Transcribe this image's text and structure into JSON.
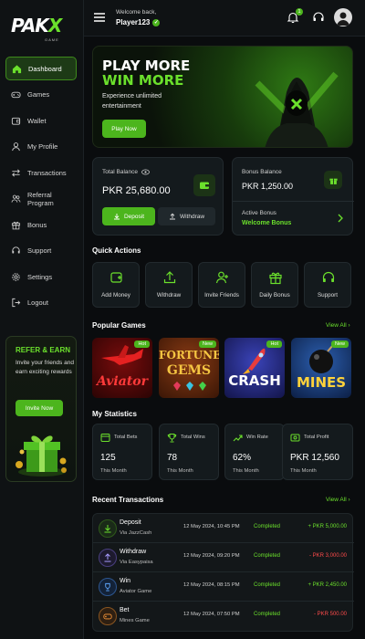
{
  "brand": {
    "logo_main": "PAK",
    "logo_x": "X",
    "logo_sub": "GAME"
  },
  "sidebar": {
    "items": [
      {
        "label": "Dashboard",
        "icon": "home-icon",
        "active": true
      },
      {
        "label": "Games",
        "icon": "gamepad-icon"
      },
      {
        "label": "Wallet",
        "icon": "wallet-icon"
      },
      {
        "label": "My Profile",
        "icon": "user-icon"
      },
      {
        "label": "Transactions",
        "icon": "transfer-icon"
      },
      {
        "label": "Referral Program",
        "icon": "users-icon"
      },
      {
        "label": "Bonus",
        "icon": "gift-icon"
      },
      {
        "label": "Support",
        "icon": "headset-icon"
      },
      {
        "label": "Settings",
        "icon": "gear-icon"
      },
      {
        "label": "Logout",
        "icon": "logout-icon"
      }
    ],
    "promo": {
      "title": "REFER & EARN",
      "text": "Invite your friends and earn exciting rewards",
      "button": "Invite Now"
    }
  },
  "header": {
    "welcome": "Welcome back,",
    "username": "Player123",
    "notification_count": "1"
  },
  "hero": {
    "title_line1": "PLAY MORE",
    "title_line2": "WIN MORE",
    "subtitle": "Experience unlimited entertainment",
    "button": "Play Now"
  },
  "balance": {
    "label": "Total Balance",
    "amount": "PKR 25,680.00",
    "deposit": "Deposit",
    "withdraw": "Withdraw"
  },
  "bonus": {
    "label": "Bonus Balance",
    "amount": "PKR 1,250.00",
    "active_label": "Active Bonus",
    "active_value": "Welcome Bonus"
  },
  "quick_actions": {
    "title": "Quick Actions",
    "items": [
      {
        "label": "Add Money",
        "icon": "wallet-plus-icon"
      },
      {
        "label": "Withdraw",
        "icon": "upload-icon"
      },
      {
        "label": "Invite Friends",
        "icon": "user-plus-icon"
      },
      {
        "label": "Daily Bonus",
        "icon": "gift-icon"
      },
      {
        "label": "Support",
        "icon": "headset-icon"
      }
    ]
  },
  "popular_games": {
    "title": "Popular Games",
    "view_all": "View All",
    "items": [
      {
        "name": "Aviator",
        "tag": "Hot"
      },
      {
        "name": "FORTUNE GEMS",
        "name_line1": "FORTUNE",
        "name_line2": "GEMS",
        "tag": "New"
      },
      {
        "name": "CRASH",
        "tag": "Hot"
      },
      {
        "name": "MINES",
        "tag": "New"
      }
    ]
  },
  "statistics": {
    "title": "My Statistics",
    "items": [
      {
        "label": "Total Bets",
        "value": "125",
        "sub": "This Month",
        "icon": "bets-icon"
      },
      {
        "label": "Total Wins",
        "value": "78",
        "sub": "This Month",
        "icon": "trophy-icon"
      },
      {
        "label": "Win Rate",
        "value": "62%",
        "sub": "This Month",
        "icon": "trend-icon"
      },
      {
        "label": "Total Profit",
        "value": "PKR 12,560",
        "sub": "This Month",
        "icon": "profit-icon"
      }
    ]
  },
  "transactions": {
    "title": "Recent Transactions",
    "view_all": "View All",
    "items": [
      {
        "type": "Deposit",
        "via": "Via JazzCash",
        "date": "12 May 2024, 10:45 PM",
        "status": "Completed",
        "amount": "+ PKR 5,000.00",
        "sign": "pos",
        "icon": "download-icon"
      },
      {
        "type": "Withdraw",
        "via": "Via Easypaisa",
        "date": "12 May 2024, 09:20 PM",
        "status": "Completed",
        "amount": "- PKR 3,000.00",
        "sign": "neg",
        "icon": "upload-icon"
      },
      {
        "type": "Win",
        "via": "Aviator Game",
        "date": "12 May 2024, 08:15 PM",
        "status": "Completed",
        "amount": "+ PKR 2,450.00",
        "sign": "pos",
        "icon": "trophy-icon"
      },
      {
        "type": "Bet",
        "via": "Mines Game",
        "date": "12 May 2024, 07:50 PM",
        "status": "Completed",
        "amount": "- PKR 500.00",
        "sign": "neg",
        "icon": "gamepad-icon"
      }
    ]
  },
  "colors": {
    "accent": "#4cb51d",
    "accent_text": "#6be02c",
    "negative": "#ff4b4b",
    "background": "#0a0c0e",
    "card": "#141a1d"
  }
}
